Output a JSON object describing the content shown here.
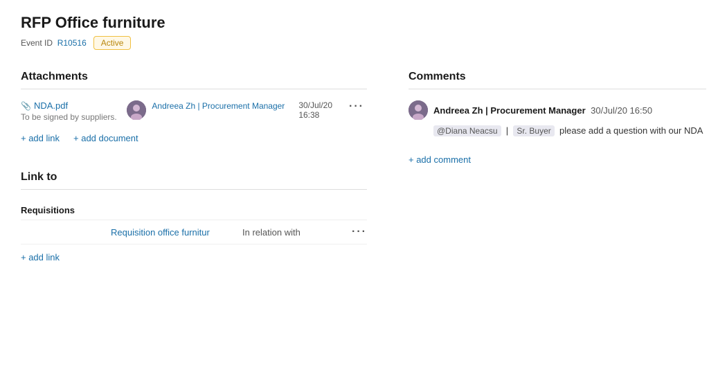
{
  "header": {
    "title": "RFP Office furniture",
    "event_id_label": "Event ID",
    "event_id_value": "R10516",
    "status": "Active"
  },
  "attachments": {
    "section_title": "Attachments",
    "files": [
      {
        "filename": "NDA.pdf",
        "description": "To be signed by suppliers.",
        "uploader_name": "Andreea Zh | Procurement Manager",
        "upload_date": "30/Jul/20",
        "upload_time": "16:38"
      }
    ],
    "add_link_label": "+ add link",
    "add_document_label": "+ add document"
  },
  "comments": {
    "section_title": "Comments",
    "items": [
      {
        "author": "Andreea Zh | Procurement Manager",
        "date": "30/Jul/20 16:50",
        "mention1": "@Diana Neacsu",
        "role1": "Sr. Buyer",
        "body_text": "please add a question with our NDA"
      }
    ],
    "add_comment_label": "+ add comment"
  },
  "link_to": {
    "section_title": "Link to",
    "columns": {
      "type": "Requisitions",
      "name": "Requisition office furnitur",
      "relation": "In relation with"
    },
    "add_link_label": "+ add link"
  },
  "icons": {
    "clip": "📎",
    "more": "···"
  }
}
